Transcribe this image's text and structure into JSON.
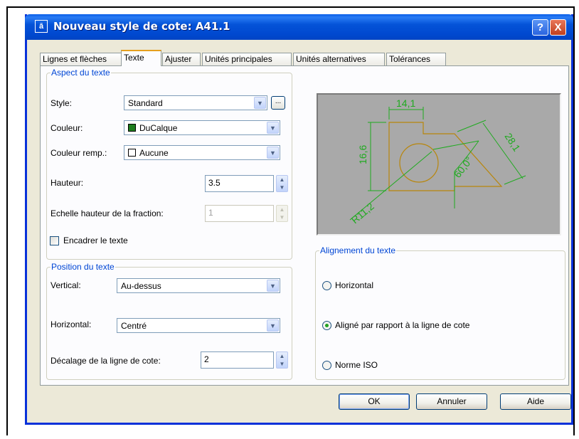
{
  "window": {
    "title": "Nouveau style de cote: A41.1",
    "help_label": "?",
    "close_label": "X"
  },
  "tabs": [
    {
      "label": "Lignes et flèches"
    },
    {
      "label": "Texte",
      "active": true
    },
    {
      "label": "Ajuster"
    },
    {
      "label": "Unités principales"
    },
    {
      "label": "Unités alternatives"
    },
    {
      "label": "Tolérances"
    }
  ],
  "aspect": {
    "legend": "Aspect du texte",
    "style_label": "Style:",
    "style_value": "Standard",
    "ellipsis_label": "...",
    "couleur_label": "Couleur:",
    "couleur_value": "DuCalque",
    "couleur_swatch": "#1e7d1e",
    "couleur_remp_label": "Couleur remp.:",
    "couleur_remp_value": "Aucune",
    "hauteur_label": "Hauteur:",
    "hauteur_value": "3.5",
    "echelle_label": "Echelle hauteur de la fraction:",
    "echelle_value": "1",
    "encadrer_label": "Encadrer le texte",
    "encadrer_checked": false
  },
  "position": {
    "legend": "Position du texte",
    "vertical_label": "Vertical:",
    "vertical_value": "Au-dessus",
    "horizontal_label": "Horizontal:",
    "horizontal_value": "Centré",
    "decalage_label": "Décalage de la ligne de cote:",
    "decalage_value": "2"
  },
  "preview": {
    "dim_top": "14,1",
    "dim_left": "16,6",
    "dim_right": "28,1",
    "dim_angle": "60,0°",
    "dim_radius": "R11,2",
    "background_color": "#a9a9a9",
    "geometry_color": "#b8860b",
    "dimension_color": "#1faa1f"
  },
  "alignement": {
    "legend": "Alignement du texte",
    "options": [
      {
        "label": "Horizontal",
        "selected": false
      },
      {
        "label": "Aligné par rapport à la ligne de cote",
        "selected": true
      },
      {
        "label": "Norme ISO",
        "selected": false
      }
    ]
  },
  "buttons": {
    "ok": "OK",
    "annuler": "Annuler",
    "aide": "Aide"
  }
}
